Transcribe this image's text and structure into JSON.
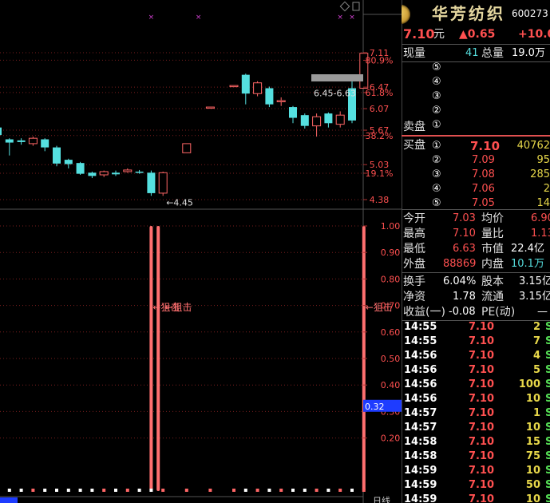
{
  "header": {
    "stock_name": "华芳纺织",
    "stock_code": "600273",
    "price": "7.10",
    "price_unit": "元",
    "change": "▲0.65",
    "change_pct": "+10.0"
  },
  "quote": {
    "cur_vol_label": "现量",
    "cur_vol": "41",
    "total_vol_label": "总量",
    "total_vol": "19.0万"
  },
  "sell_orders": {
    "label": "卖盘",
    "levels": [
      "⑤",
      "④",
      "③",
      "②",
      "①"
    ]
  },
  "buy_orders": {
    "label": "买盘",
    "rows": [
      {
        "level": "①",
        "price": "7.10",
        "volume": "40762"
      },
      {
        "level": "②",
        "price": "7.09",
        "volume": "95"
      },
      {
        "level": "③",
        "price": "7.08",
        "volume": "285"
      },
      {
        "level": "④",
        "price": "7.06",
        "volume": "2"
      },
      {
        "level": "⑤",
        "price": "7.05",
        "volume": "14"
      }
    ]
  },
  "stats": {
    "open_label": "今开",
    "open": "7.03",
    "avg_label": "均价",
    "avg": "6.90",
    "high_label": "最高",
    "high": "7.10",
    "ratio_label": "量比",
    "ratio": "1.13",
    "low_label": "最低",
    "low": "6.63",
    "mcap_label": "市值",
    "mcap": "22.4亿",
    "outer_label": "外盘",
    "outer": "88869",
    "inner_label": "内盘",
    "inner": "10.1万",
    "turnover_label": "换手",
    "turnover": "6.04%",
    "shares_label": "股本",
    "shares": "3.15亿",
    "nav_label": "净资",
    "nav": "1.78",
    "float_label": "流通",
    "float": "3.15亿",
    "eps_label": "收益(一)",
    "eps": "-0.08",
    "pe_label": "PE(动)",
    "pe": "—"
  },
  "ticks": [
    {
      "time": "14:55",
      "price": "7.10",
      "vol": "2",
      "side": "S"
    },
    {
      "time": "14:55",
      "price": "7.10",
      "vol": "7",
      "side": "S"
    },
    {
      "time": "14:56",
      "price": "7.10",
      "vol": "4",
      "side": "S"
    },
    {
      "time": "14:56",
      "price": "7.10",
      "vol": "5",
      "side": "S"
    },
    {
      "time": "14:56",
      "price": "7.10",
      "vol": "100",
      "side": "S"
    },
    {
      "time": "14:56",
      "price": "7.10",
      "vol": "10",
      "side": "S"
    },
    {
      "time": "14:57",
      "price": "7.10",
      "vol": "1",
      "side": "S"
    },
    {
      "time": "14:57",
      "price": "7.10",
      "vol": "10",
      "side": "S"
    },
    {
      "time": "14:58",
      "price": "7.10",
      "vol": "15",
      "side": "S"
    },
    {
      "time": "14:58",
      "price": "7.10",
      "vol": "75",
      "side": "S"
    },
    {
      "time": "14:59",
      "price": "7.10",
      "vol": "10",
      "side": "S"
    },
    {
      "time": "14:59",
      "price": "7.10",
      "vol": "50",
      "side": "S"
    },
    {
      "time": "14:59",
      "price": "7.10",
      "vol": "10",
      "side": "S"
    }
  ],
  "kline": {
    "price_axis": [
      {
        "label": "7.11",
        "price": 7.11
      },
      {
        "label": "80.9%",
        "price": 6.97
      },
      {
        "label": "6.47",
        "price": 6.47
      },
      {
        "label": "61.8%",
        "price": 6.37
      },
      {
        "label": "6.07",
        "price": 6.07
      },
      {
        "label": "5.67",
        "price": 5.67
      },
      {
        "label": "38.2%",
        "price": 5.57
      },
      {
        "label": "5.03",
        "price": 5.03
      },
      {
        "label": "19.1%",
        "price": 4.87
      },
      {
        "label": "4.38",
        "price": 4.38
      }
    ],
    "low_annotation": "←4.45",
    "range_label": "6.45-6.63",
    "candles": [
      {
        "o": 5.72,
        "c": 5.58,
        "h": 5.76,
        "l": 5.52
      },
      {
        "o": 5.5,
        "c": 5.44,
        "h": 5.52,
        "l": 5.2
      },
      {
        "o": 5.48,
        "c": 5.45,
        "h": 5.52,
        "l": 5.4
      },
      {
        "o": 5.42,
        "c": 5.52,
        "h": 5.55,
        "l": 5.38
      },
      {
        "o": 5.5,
        "c": 5.35,
        "h": 5.52,
        "l": 5.28
      },
      {
        "o": 5.35,
        "c": 5.05,
        "h": 5.38,
        "l": 5.0
      },
      {
        "o": 5.12,
        "c": 5.04,
        "h": 5.14,
        "l": 4.96
      },
      {
        "o": 5.06,
        "c": 4.86,
        "h": 5.08,
        "l": 4.84
      },
      {
        "o": 4.88,
        "c": 4.82,
        "h": 4.9,
        "l": 4.78
      },
      {
        "o": 4.84,
        "c": 4.9,
        "h": 4.92,
        "l": 4.8
      },
      {
        "o": 4.88,
        "c": 4.85,
        "h": 4.92,
        "l": 4.82
      },
      {
        "o": 4.9,
        "c": 4.93,
        "h": 4.96,
        "l": 4.88
      },
      {
        "o": 4.9,
        "c": 4.88,
        "h": 4.93,
        "l": 4.86
      },
      {
        "o": 4.88,
        "c": 4.5,
        "h": 4.92,
        "l": 4.45
      },
      {
        "o": 4.5,
        "c": 4.88,
        "h": 4.9,
        "l": 4.45
      },
      null,
      {
        "o": 5.25,
        "c": 5.42,
        "h": 5.42,
        "l": 5.25
      },
      null,
      {
        "o": 6.1,
        "c": 6.1,
        "h": 6.1,
        "l": 6.1
      },
      null,
      {
        "o": 6.5,
        "c": 6.5,
        "h": 6.5,
        "l": 6.5
      },
      {
        "o": 6.7,
        "c": 6.35,
        "h": 6.72,
        "l": 6.15
      },
      {
        "o": 6.35,
        "c": 6.55,
        "h": 6.58,
        "l": 6.3
      },
      {
        "o": 6.45,
        "c": 6.15,
        "h": 6.48,
        "l": 6.1
      },
      {
        "o": 6.2,
        "c": 6.22,
        "h": 6.28,
        "l": 6.12
      },
      {
        "o": 6.1,
        "c": 5.9,
        "h": 6.12,
        "l": 5.8
      },
      {
        "o": 5.95,
        "c": 5.75,
        "h": 5.98,
        "l": 5.7
      },
      {
        "o": 5.75,
        "c": 5.92,
        "h": 5.98,
        "l": 5.55
      },
      {
        "o": 5.98,
        "c": 5.8,
        "h": 6.0,
        "l": 5.72
      },
      {
        "o": 5.78,
        "c": 5.95,
        "h": 6.02,
        "l": 5.72
      },
      {
        "o": 6.45,
        "c": 5.85,
        "h": 6.63,
        "l": 5.8
      },
      {
        "o": 6.45,
        "c": 7.1,
        "h": 7.1,
        "l": 6.45
      }
    ],
    "marker_candles": [
      13,
      17,
      29,
      30
    ]
  },
  "indicator": {
    "axis": [
      "1.00",
      "0.90",
      "0.80",
      "0.70",
      "0.60",
      "0.50",
      "0.40",
      "0.30",
      "0.20"
    ],
    "current_value": "0.32",
    "signal_label": "←狙击",
    "signals": [
      13,
      14,
      31
    ],
    "bottom_label": "日线"
  }
}
